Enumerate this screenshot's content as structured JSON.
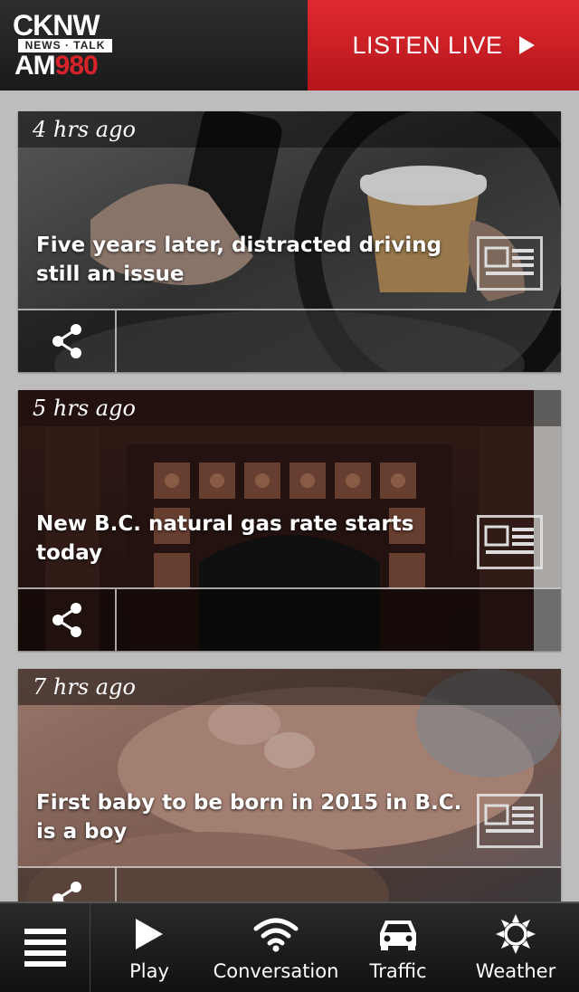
{
  "header": {
    "logo": {
      "line1": "CKNW",
      "line2": "NEWS · TALK",
      "line3_am": "AM",
      "line3_num": "980"
    },
    "listen_live_label": "LISTEN LIVE"
  },
  "cards": [
    {
      "time": "4 hrs ago",
      "title": "Five years later, distracted driving still an issue"
    },
    {
      "time": "5 hrs ago",
      "title": "New B.C. natural gas rate starts today"
    },
    {
      "time": "7 hrs ago",
      "title": "First baby to be born in 2015 in B.C. is a boy"
    }
  ],
  "bottom_nav": {
    "items": [
      {
        "label": "Play",
        "icon": "play-icon"
      },
      {
        "label": "Conversation",
        "icon": "wifi-icon"
      },
      {
        "label": "Traffic",
        "icon": "car-icon"
      },
      {
        "label": "Weather",
        "icon": "sun-icon"
      }
    ]
  },
  "colors": {
    "brand_red": "#d8232a",
    "header_dark": "#222222",
    "background": "#bdbdbd"
  }
}
